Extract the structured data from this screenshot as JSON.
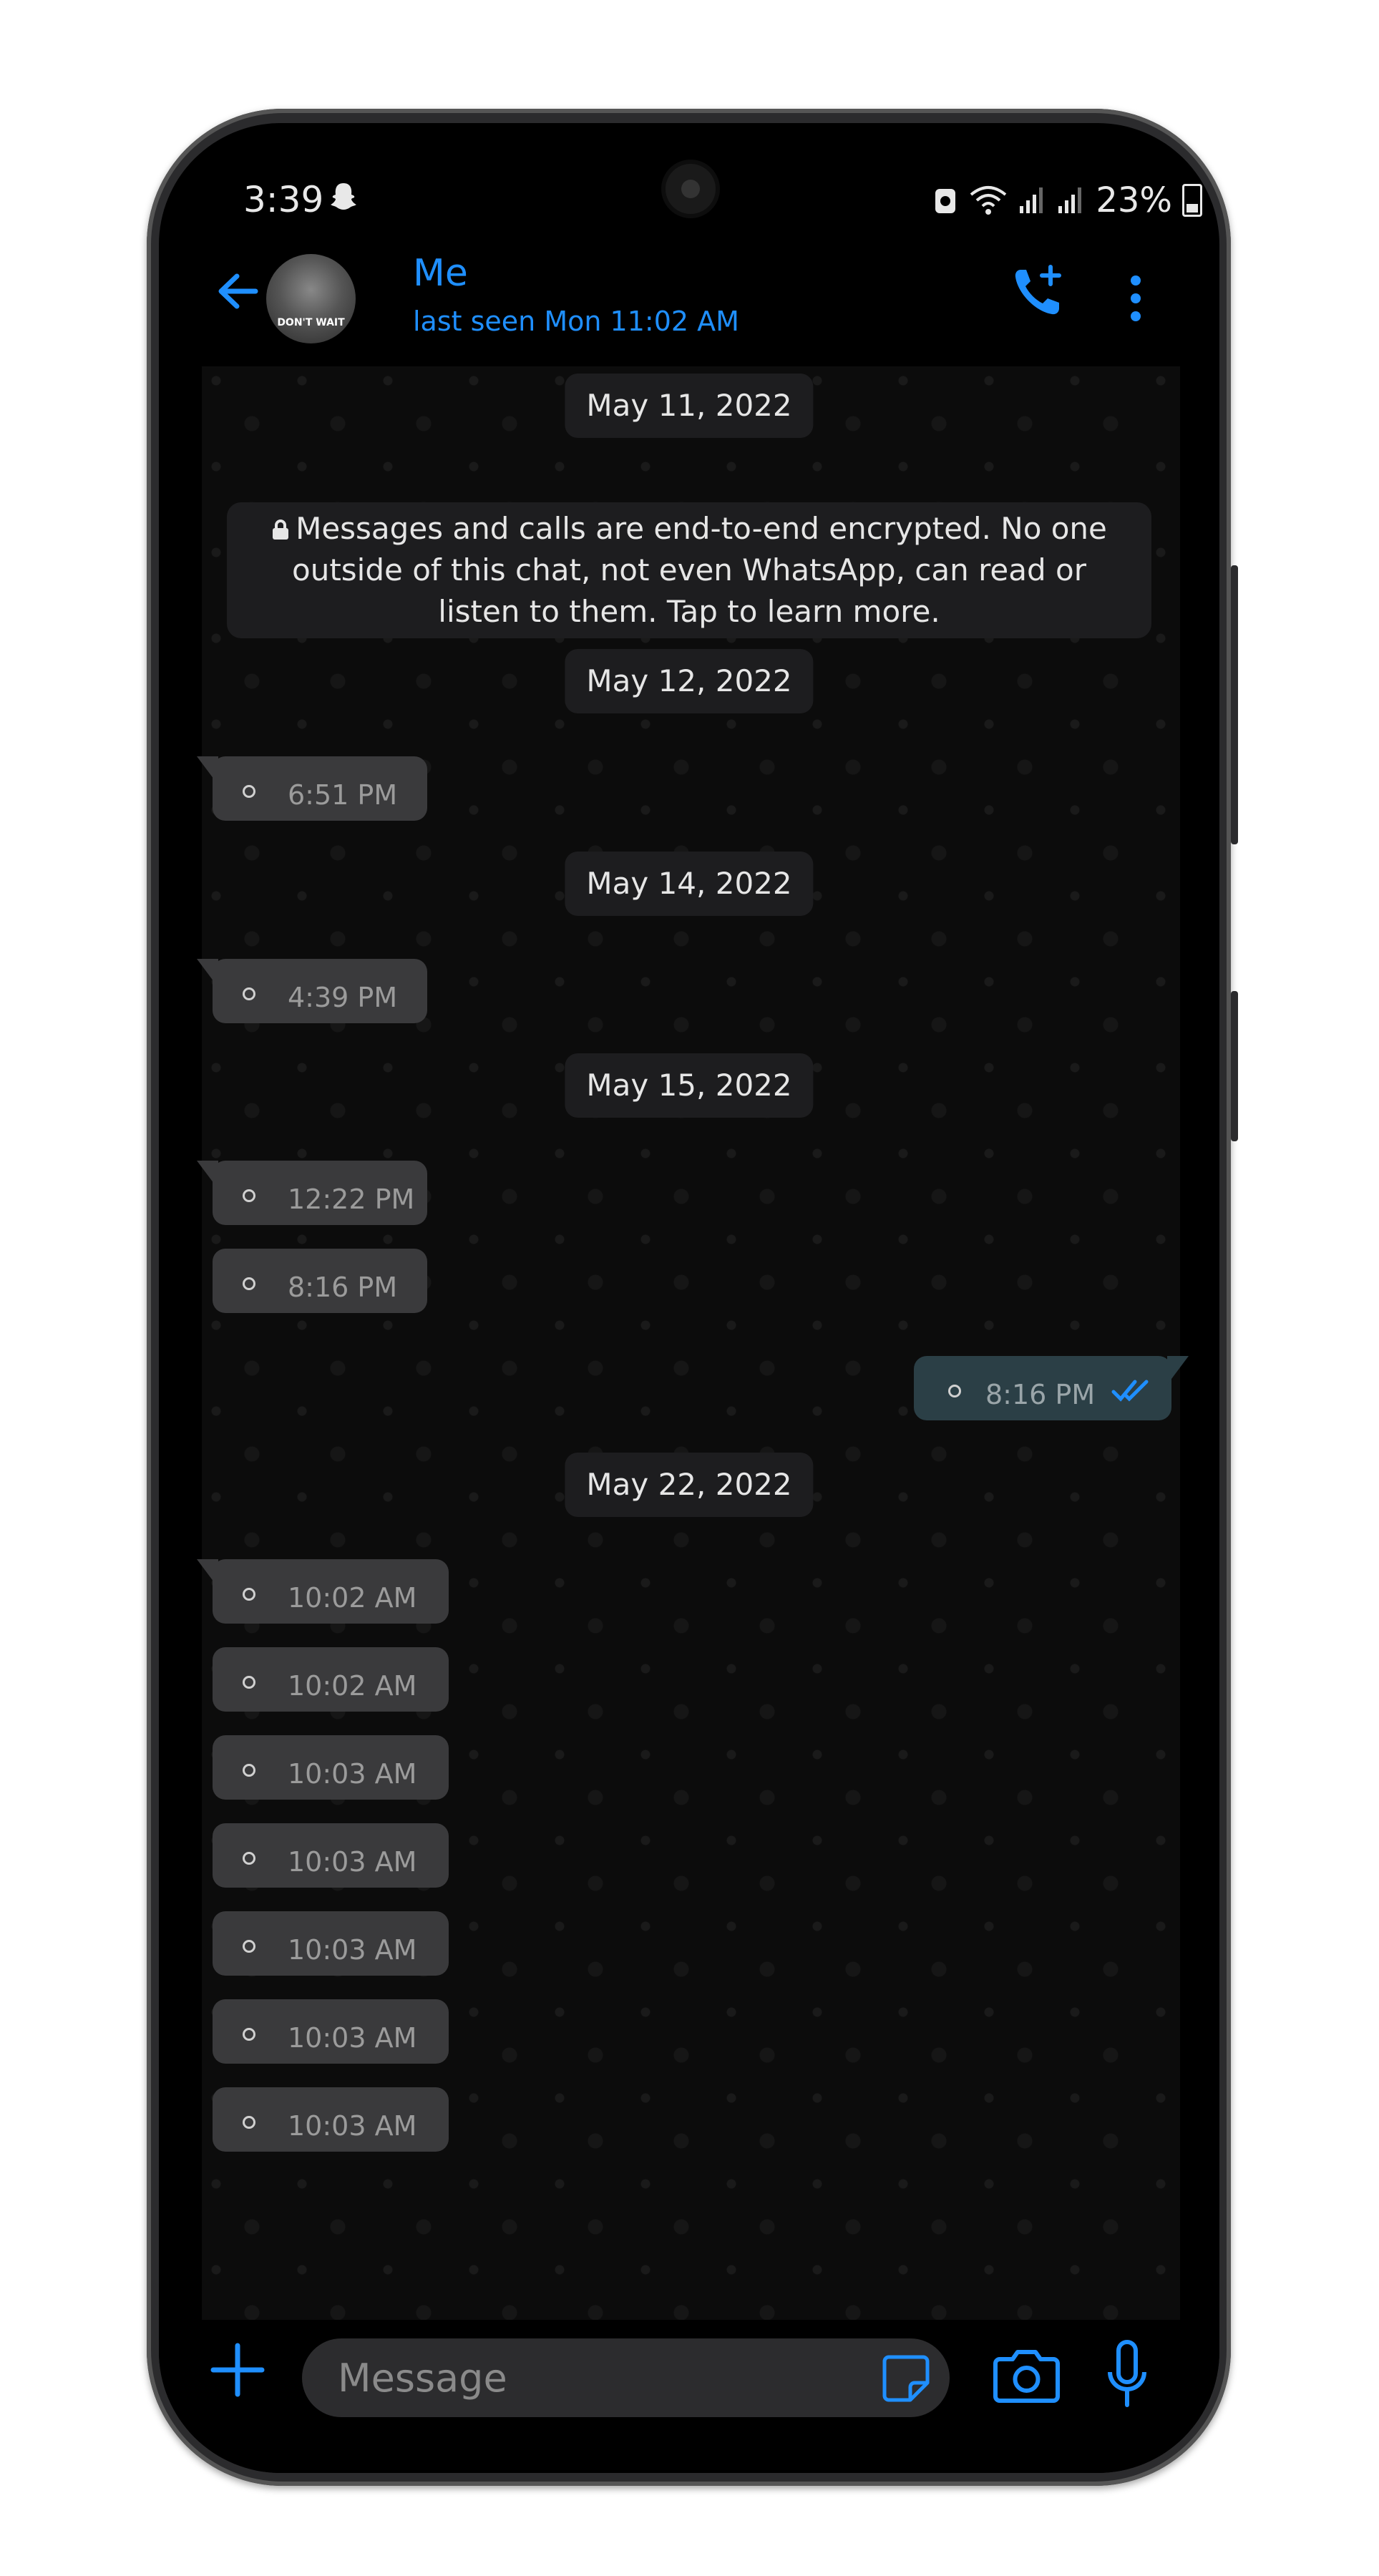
{
  "status_bar": {
    "time": "3:39",
    "battery": "23%"
  },
  "header": {
    "contact_name": "Me",
    "last_seen": "last seen Mon 11:02 AM",
    "avatar_text": "DON'T WAIT"
  },
  "encryption_notice": {
    "line1": "Messages and calls are end-to-end encrypted. No one",
    "line2": "outside of this chat, not even WhatsApp, can read or",
    "line3": "listen to them. Tap to learn more."
  },
  "dates": {
    "d1": "May 11, 2022",
    "d2": "May 12, 2022",
    "d3": "May 14, 2022",
    "d4": "May 15, 2022",
    "d5": "May 22, 2022"
  },
  "messages": {
    "m1": "6:51 PM",
    "m2": "4:39 PM",
    "m3": "12:22 PM",
    "m4": "8:16 PM",
    "m5_out": "8:16 PM",
    "m6": "10:02 AM",
    "m7": "10:02 AM",
    "m8": "10:03 AM",
    "m9": "10:03 AM",
    "m10": "10:03 AM",
    "m11": "10:03 AM",
    "m12": "10:03 AM"
  },
  "input": {
    "placeholder": "Message"
  },
  "colors": {
    "accent": "#1f8fff",
    "incoming_bubble": "#3a3a3c",
    "outgoing_bubble": "#2b3f46",
    "background": "#0c0c0c"
  }
}
